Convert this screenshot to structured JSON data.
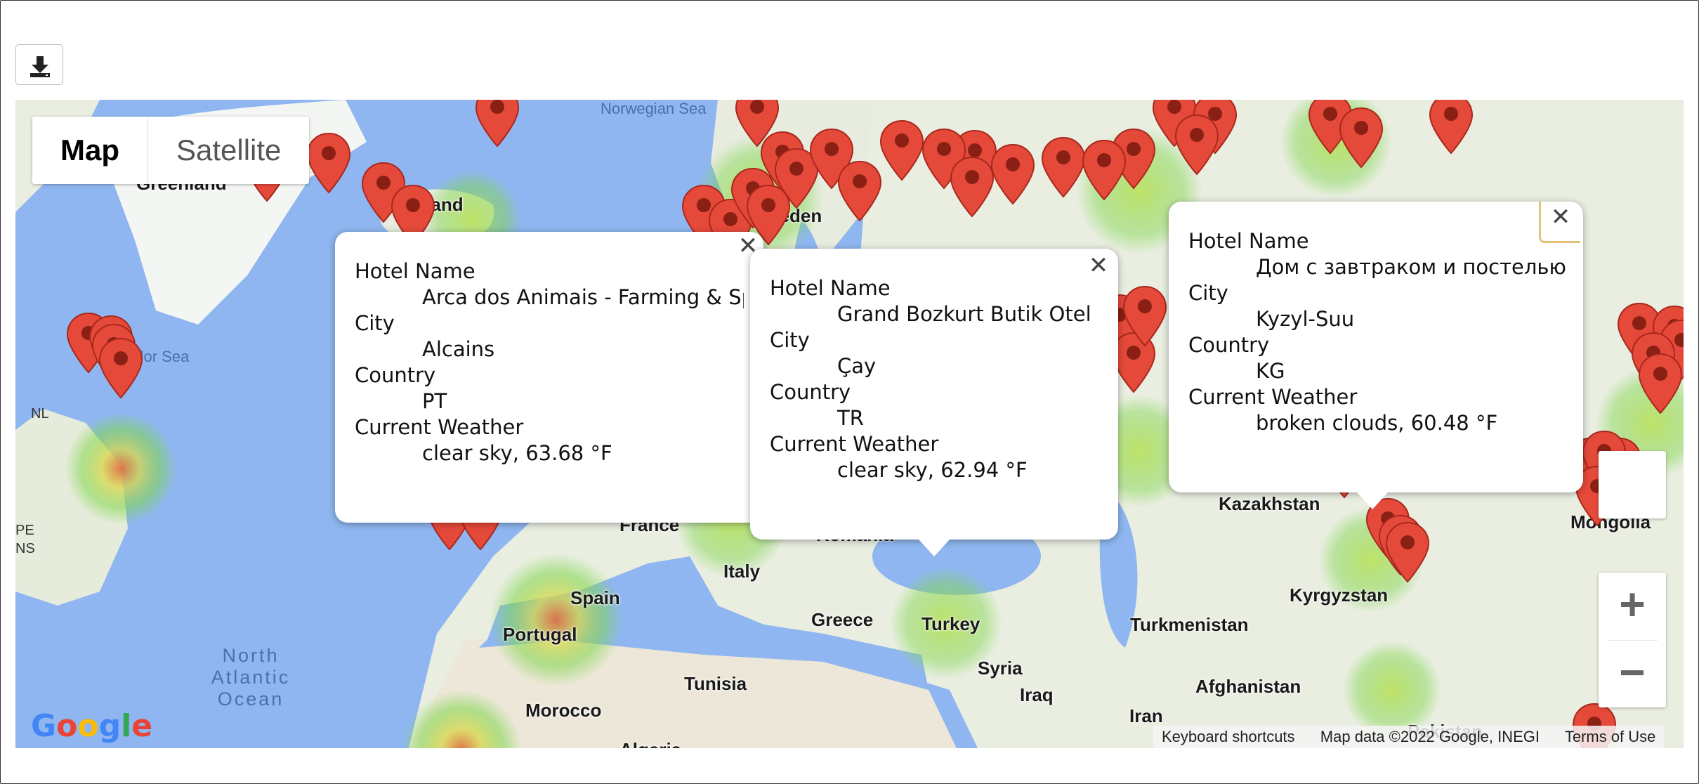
{
  "toolbar": {
    "download_icon": "download-icon"
  },
  "map_type": {
    "map_label": "Map",
    "satellite_label": "Satellite",
    "selected": "Map"
  },
  "map_labels": {
    "oceans": [
      "Norwegian Sea",
      "Labrador Sea",
      "North Atlantic Ocean"
    ],
    "places": [
      "Greenland",
      "Iceland",
      "NL",
      "PE",
      "NS",
      "France",
      "Spain",
      "Portugal",
      "Italy",
      "Romania",
      "Greece",
      "Turkey",
      "Syria",
      "Iraq",
      "Iran",
      "Tunisia",
      "Morocco",
      "Algeria",
      "Turkmenistan",
      "Afghanistan",
      "Kazakhstan",
      "Kyrgyzstan",
      "Mongolia",
      "Pakistan",
      "Sweden"
    ]
  },
  "info_windows": [
    {
      "hotel_name_label": "Hotel Name",
      "hotel_name": "Arca dos Animais - Farming & Spa",
      "city_label": "City",
      "city": "Alcains",
      "country_label": "Country",
      "country": "PT",
      "weather_label": "Current Weather",
      "weather": "clear sky, 63.68 °F"
    },
    {
      "hotel_name_label": "Hotel Name",
      "hotel_name": "Grand Bozkurt Butik Otel",
      "city_label": "City",
      "city": "Çay",
      "country_label": "Country",
      "country": "TR",
      "weather_label": "Current Weather",
      "weather": "clear sky, 62.94 °F"
    },
    {
      "hotel_name_label": "Hotel Name",
      "hotel_name": "Дом с завтраком и постелью",
      "city_label": "City",
      "city": "Kyzyl-Suu",
      "country_label": "Country",
      "country": "KG",
      "weather_label": "Current Weather",
      "weather": "broken clouds, 60.48 °F"
    }
  ],
  "controls": {
    "zoom_in": "+",
    "zoom_out": "−",
    "close_icon": "close-icon"
  },
  "footer": {
    "google_logo": "Google",
    "keyboard_shortcuts": "Keyboard shortcuts",
    "map_data": "Map data ©2022 Google, INEGI",
    "terms": "Terms of Use"
  },
  "colors": {
    "marker": "#e5493a",
    "marker_dot": "#8a1f14",
    "water": "#8fb6f0",
    "land": "#e9eee1",
    "heat": "#7fd64a"
  }
}
